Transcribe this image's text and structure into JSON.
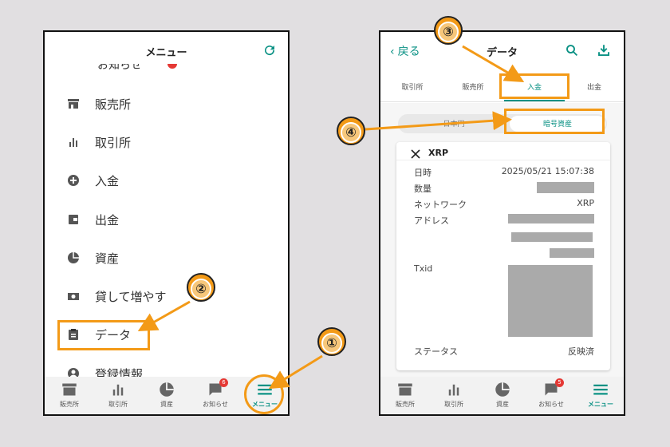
{
  "left": {
    "header_title": "メニュー",
    "partial_item": "お知らせ",
    "menu": [
      {
        "label": "販売所",
        "icon": "store-icon"
      },
      {
        "label": "取引所",
        "icon": "bar-chart-icon"
      },
      {
        "label": "入金",
        "icon": "plus-circle-icon"
      },
      {
        "label": "出金",
        "icon": "wallet-icon"
      },
      {
        "label": "資産",
        "icon": "pie-chart-icon"
      },
      {
        "label": "貸して増やす",
        "icon": "cash-icon"
      },
      {
        "label": "データ",
        "icon": "clipboard-icon"
      },
      {
        "label": "登録情報",
        "icon": "account-icon"
      }
    ],
    "nav": [
      {
        "label": "販売所"
      },
      {
        "label": "取引所"
      },
      {
        "label": "資産"
      },
      {
        "label": "お知らせ",
        "badge": "6"
      },
      {
        "label": "メニュー"
      }
    ]
  },
  "right": {
    "back_label": "戻る",
    "header_title": "データ",
    "tabs": [
      {
        "label": "取引所"
      },
      {
        "label": "販売所"
      },
      {
        "label": "入金"
      },
      {
        "label": "出金"
      }
    ],
    "toggle": [
      "日本円",
      "暗号資産"
    ],
    "card": {
      "coin": "XRP",
      "rows": {
        "datetime_key": "日時",
        "datetime_val": "2025/05/21 15:07:38",
        "amount_key": "数量",
        "network_key": "ネットワーク",
        "network_val": "XRP",
        "address_key": "アドレス",
        "txid_key": "Txid",
        "status_key": "ステータス",
        "status_val": "反映済"
      }
    },
    "nav": [
      {
        "label": "販売所"
      },
      {
        "label": "取引所"
      },
      {
        "label": "資産"
      },
      {
        "label": "お知らせ",
        "badge": "5"
      },
      {
        "label": "メニュー"
      }
    ]
  },
  "annotations": [
    "①",
    "②",
    "③",
    "④"
  ],
  "colors": {
    "accent": "#0a9184",
    "highlight": "#f39a17",
    "badge": "#e53935"
  }
}
